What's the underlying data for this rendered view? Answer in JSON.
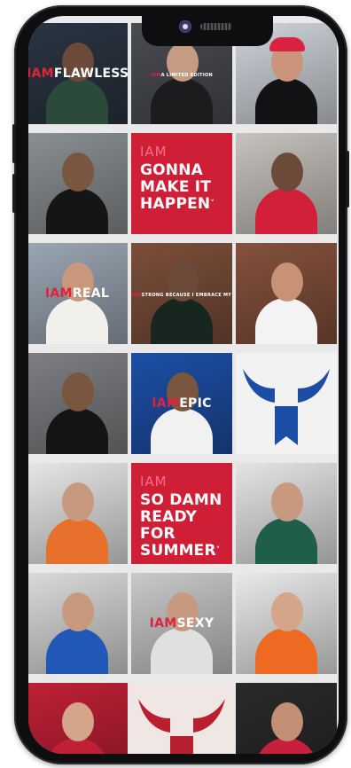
{
  "tiles": [
    {
      "id": "r1c1",
      "kind": "photo",
      "bg": "#2a3542",
      "skin": "#6b4a3a",
      "top": "#2b4a3a",
      "overlay": {
        "iam": "IAM",
        "rest": "FLAWLESS",
        "size": "big"
      }
    },
    {
      "id": "r1c2",
      "kind": "photo",
      "bg": "#4a4c52",
      "skin": "#c59b82",
      "top": "#1c1c1e",
      "overlay": {
        "iam": "IAM",
        "rest": "A LIMITED EDITION",
        "size": "small"
      }
    },
    {
      "id": "r1c3",
      "kind": "photo",
      "bg": "#cfd4da",
      "skin": "#c99479",
      "top": "#121214",
      "cap": "#d92340"
    },
    {
      "id": "r2c1",
      "kind": "photo",
      "bg": "#8a8f92",
      "skin": "#7a563f",
      "top": "#151515"
    },
    {
      "id": "r2c2",
      "kind": "quote",
      "iam": "IAM",
      "lines": [
        "GONNA",
        "MAKE IT",
        "HAPPEN"
      ]
    },
    {
      "id": "r2c3",
      "kind": "photo",
      "bg": "#c6c2bd",
      "skin": "#6b4a3a",
      "top": "#d2203a"
    },
    {
      "id": "r3c1",
      "kind": "photo",
      "bg": "#9aa6b3",
      "skin": "#c9977b",
      "top": "#f1f0ec",
      "overlay": {
        "iam": "IAM",
        "rest": "REAL",
        "size": "big"
      }
    },
    {
      "id": "r3c2",
      "kind": "photo",
      "bg": "#7c4e3a",
      "skin": "#6b4a3a",
      "top": "#17271f",
      "overlay": {
        "iam": "IAM",
        "rest": "STRONG BECAUSE I EMBRACE MY WEAKNESS",
        "size": "small"
      }
    },
    {
      "id": "r3c3",
      "kind": "photo",
      "bg": "#85513d",
      "skin": "#c79275",
      "top": "#f3f3f3"
    },
    {
      "id": "r4c1",
      "kind": "photo",
      "bg": "#7d7f82",
      "skin": "#7a563f",
      "top": "#141414"
    },
    {
      "id": "r4c2",
      "kind": "photo",
      "bg": "#1d4fa5",
      "skin": "#7a563f",
      "top": "#f1f1f1",
      "overlay": {
        "iam": "IAM",
        "rest": "EPIC",
        "size": "big"
      }
    },
    {
      "id": "r4c3",
      "kind": "logo",
      "bg": "#f2f2f2",
      "mark": "#1c4ea6"
    },
    {
      "id": "r5c1",
      "kind": "photo",
      "bg": "#e6e6e6",
      "skin": "#c79a80",
      "top": "#e8702d"
    },
    {
      "id": "r5c2",
      "kind": "quote",
      "iam": "IAM",
      "lines": [
        "SO DAMN",
        "READY FOR",
        "SUMMER"
      ]
    },
    {
      "id": "r5c3",
      "kind": "photo",
      "bg": "#e4e4e4",
      "skin": "#c79a80",
      "top": "#1e5e4a"
    },
    {
      "id": "r6c1",
      "kind": "photo",
      "bg": "#dadada",
      "skin": "#c79a80",
      "top": "#2158b8"
    },
    {
      "id": "r6c2",
      "kind": "photo",
      "bg": "#c9c9c9",
      "skin": "#c79a80",
      "top": "#e0e0e0",
      "overlay": {
        "iam": "IAM",
        "rest": "SEXY",
        "size": "big"
      }
    },
    {
      "id": "r6c3",
      "kind": "photo",
      "bg": "#e9e9e9",
      "skin": "#d5a58a",
      "top": "#ee6a23"
    },
    {
      "id": "r7c1",
      "kind": "photo",
      "bg": "#c02036",
      "skin": "#d5a58a",
      "top": "#c02036"
    },
    {
      "id": "r7c2",
      "kind": "logo",
      "bg": "#f0e6e3",
      "mark": "#b9202f"
    },
    {
      "id": "r7c3",
      "kind": "photo",
      "bg": "#2a2a2a",
      "skin": "#c08f74",
      "top": "#c6203a"
    }
  ]
}
